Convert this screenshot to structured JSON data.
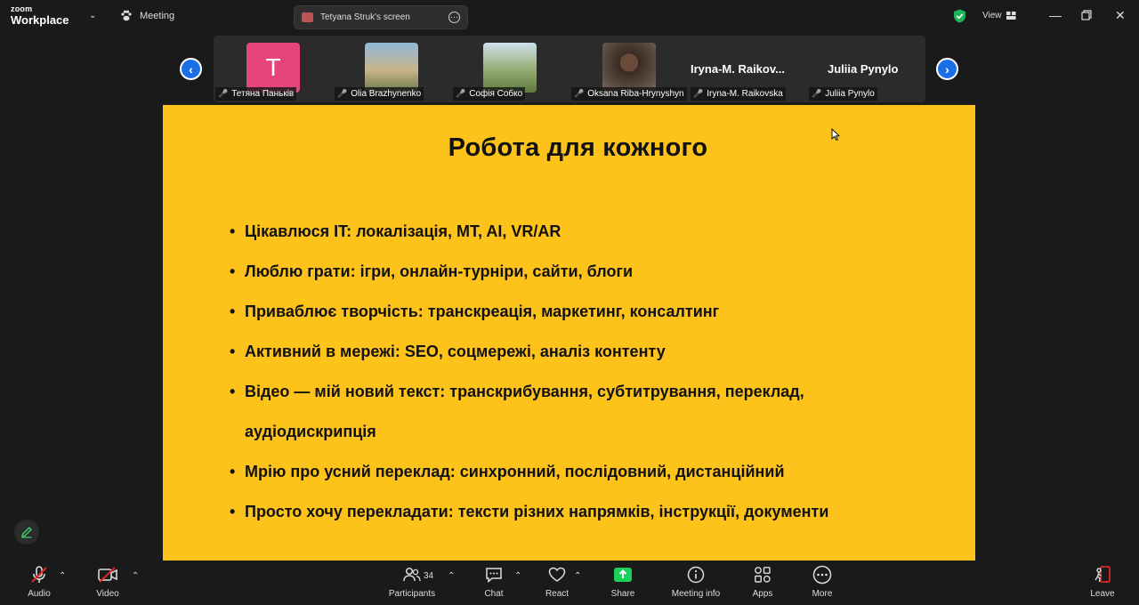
{
  "app": {
    "logo_line1": "zoom",
    "logo_line2": "Workplace",
    "meeting_label": "Meeting",
    "share_banner": "Tetyana Struk's screen",
    "view_label": "View"
  },
  "gallery": {
    "participants": [
      {
        "name": "Тетяна Паньків",
        "initial": "T",
        "tile": "initial"
      },
      {
        "name": "Olia Brazhynenko",
        "tile": "photo"
      },
      {
        "name": "Софія Собко",
        "tile": "photo"
      },
      {
        "name": "Oksana Riba-Hrynyshyn",
        "tile": "photo"
      },
      {
        "name": "Iryna-M. Raikovska",
        "display": "Iryna-M.  Raikov..."
      },
      {
        "name": "Juliia Pynylo",
        "display": "Juliia Pynylo"
      }
    ]
  },
  "slide": {
    "title": "Робота для кожного",
    "bullets": [
      "Цікавлюся IT: локалізація, MT, AI, VR/AR",
      "Люблю грати: ігри, онлайн-турніри, сайти, блоги",
      "Приваблює творчість: транскреація, маркетинг, консалтинг",
      "Активний в мережі: SEO, соцмережі, аналіз контенту",
      "Відео — мій новий текст: транскрибування, субтитрування, переклад, аудіодискрипція",
      "Мрію про усний переклад: синхронний, послідовний, дистанційний",
      "Просто хочу перекладати: тексти різних напрямків, інструкції, документи"
    ],
    "background": "#fec31b"
  },
  "toolbar": {
    "audio": "Audio",
    "video": "Video",
    "participants": "Participants",
    "participants_count": "34",
    "chat": "Chat",
    "react": "React",
    "share": "Share",
    "meeting_info": "Meeting info",
    "apps": "Apps",
    "more": "More",
    "leave": "Leave"
  },
  "colors": {
    "share_green": "#1ad15a",
    "nav_blue": "#1b6fe6",
    "muted_red": "#e02828",
    "shield_green": "#1fb35a"
  }
}
